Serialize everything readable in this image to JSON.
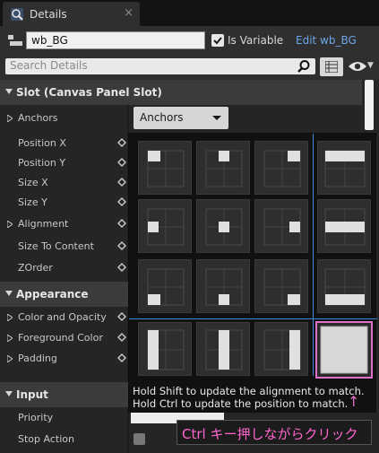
{
  "tab": {
    "label": "Details",
    "close": "×",
    "icon": "details-search-icon"
  },
  "header": {
    "name_value": "wb_BG",
    "is_variable_label": "Is Variable",
    "is_variable_checked": true,
    "edit_link": "Edit wb_BG"
  },
  "search": {
    "placeholder": "Search Details"
  },
  "sections": {
    "slot": "Slot (Canvas Panel Slot)",
    "appearance": "Appearance",
    "input": "Input"
  },
  "slot_rows": {
    "anchors": "Anchors",
    "position_x": "Position X",
    "position_y": "Position Y",
    "size_x": "Size X",
    "size_y": "Size Y",
    "alignment": "Alignment",
    "size_to_content": "Size To Content",
    "zorder": "ZOrder"
  },
  "appearance_rows": {
    "color_and_opacity": "Color and Opacity",
    "foreground_color": "Foreground Color",
    "padding": "Padding"
  },
  "input_rows": {
    "priority": "Priority",
    "stop_action": "Stop Action"
  },
  "anchors_dropdown": {
    "label": "Anchors"
  },
  "popup": {
    "hint_line1": "Hold Shift to update the alignment to match.",
    "hint_line2": "Hold Ctrl to update the position to match.",
    "selected_preset": "stretch-both"
  },
  "annotation": {
    "text": "Ctrl キー押しながらクリック",
    "arrow": "↑"
  },
  "colors": {
    "accent_blue": "#3b8ad8",
    "highlight_pink": "#e070c8",
    "link_blue": "#6ba6e8"
  }
}
